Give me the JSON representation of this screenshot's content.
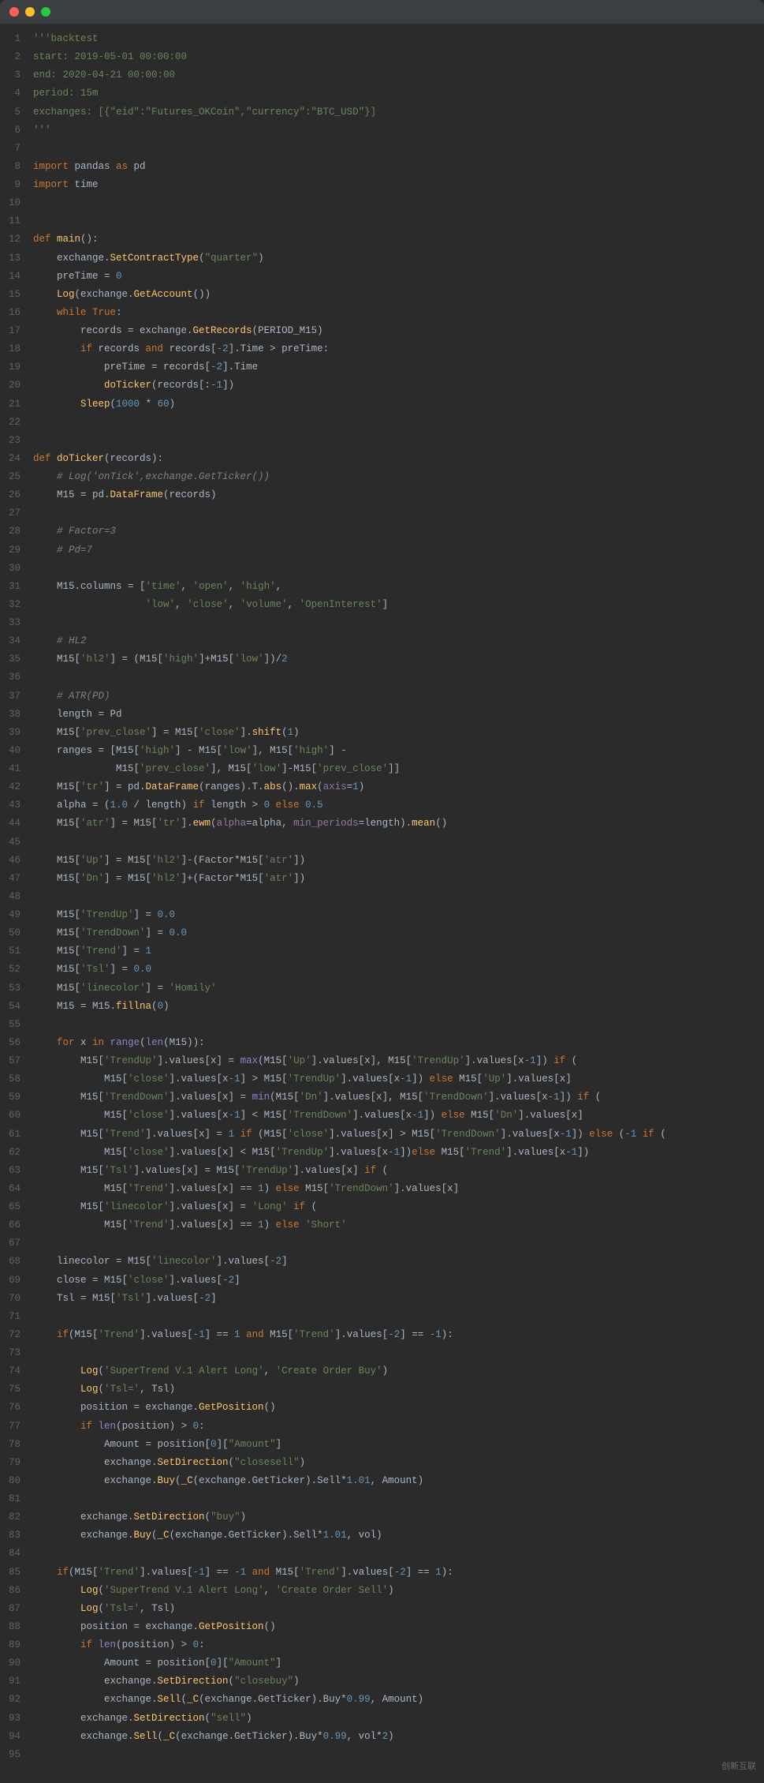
{
  "lines": [
    {
      "n": 1,
      "html": "<span class='str'>'''backtest</span>"
    },
    {
      "n": 2,
      "html": "<span class='str'>start: 2019-05-01 00:00:00</span>"
    },
    {
      "n": 3,
      "html": "<span class='str'>end: 2020-04-21 00:00:00</span>"
    },
    {
      "n": 4,
      "html": "<span class='str'>period: 15m</span>"
    },
    {
      "n": 5,
      "html": "<span class='str'>exchanges: [{\"eid\":\"Futures_OKCoin\",\"currency\":\"BTC_USD\"}]</span>"
    },
    {
      "n": 6,
      "html": "<span class='str'>'''</span>"
    },
    {
      "n": 7,
      "html": ""
    },
    {
      "n": 8,
      "html": "<span class='kw'>import</span> pandas <span class='kw'>as</span> pd"
    },
    {
      "n": 9,
      "html": "<span class='kw'>import</span> time"
    },
    {
      "n": 10,
      "html": ""
    },
    {
      "n": 11,
      "html": ""
    },
    {
      "n": 12,
      "html": "<span class='kw'>def</span> <span class='fn'>main</span>():"
    },
    {
      "n": 13,
      "html": "    exchange.<span class='fn'>SetContractType</span>(<span class='str'>\"quarter\"</span>)"
    },
    {
      "n": 14,
      "html": "    preTime = <span class='num'>0</span>"
    },
    {
      "n": 15,
      "html": "    <span class='fn'>Log</span>(exchange.<span class='fn'>GetAccount</span>())"
    },
    {
      "n": 16,
      "html": "    <span class='kw'>while</span> <span class='kw'>True</span>:"
    },
    {
      "n": 17,
      "html": "        records = exchange.<span class='fn'>GetRecords</span>(PERIOD_M15)"
    },
    {
      "n": 18,
      "html": "        <span class='kw'>if</span> records <span class='kw'>and</span> records[<span class='num'>-2</span>].Time &gt; preTime:"
    },
    {
      "n": 19,
      "html": "            preTime = records[<span class='num'>-2</span>].Time"
    },
    {
      "n": 20,
      "html": "            <span class='fn'>doTicker</span>(records[:<span class='num'>-1</span>])"
    },
    {
      "n": 21,
      "html": "        <span class='fn'>Sleep</span>(<span class='num'>1000</span> * <span class='num'>60</span>)"
    },
    {
      "n": 22,
      "html": ""
    },
    {
      "n": 23,
      "html": ""
    },
    {
      "n": 24,
      "html": "<span class='kw'>def</span> <span class='fn'>doTicker</span>(records):"
    },
    {
      "n": 25,
      "html": "    <span class='comment'># Log('onTick',exchange.GetTicker())</span>"
    },
    {
      "n": 26,
      "html": "    M15 = pd.<span class='fn'>DataFrame</span>(records)"
    },
    {
      "n": 27,
      "html": ""
    },
    {
      "n": 28,
      "html": "    <span class='comment'># Factor=3</span>"
    },
    {
      "n": 29,
      "html": "    <span class='comment'># Pd=7</span>"
    },
    {
      "n": 30,
      "html": ""
    },
    {
      "n": 31,
      "html": "    M15.columns = [<span class='str'>'time'</span>, <span class='str'>'open'</span>, <span class='str'>'high'</span>,"
    },
    {
      "n": 32,
      "html": "                   <span class='str'>'low'</span>, <span class='str'>'close'</span>, <span class='str'>'volume'</span>, <span class='str'>'OpenInterest'</span>]"
    },
    {
      "n": 33,
      "html": ""
    },
    {
      "n": 34,
      "html": "    <span class='comment'># HL2</span>"
    },
    {
      "n": 35,
      "html": "    M15[<span class='str'>'hl2'</span>] = (M15[<span class='str'>'high'</span>]+M15[<span class='str'>'low'</span>])/<span class='num'>2</span>"
    },
    {
      "n": 36,
      "html": ""
    },
    {
      "n": 37,
      "html": "    <span class='comment'># ATR(PD)</span>"
    },
    {
      "n": 38,
      "html": "    length = Pd"
    },
    {
      "n": 39,
      "html": "    M15[<span class='str'>'prev_close'</span>] = M15[<span class='str'>'close'</span>].<span class='fn'>shift</span>(<span class='num'>1</span>)"
    },
    {
      "n": 40,
      "html": "    ranges = [M15[<span class='str'>'high'</span>] - M15[<span class='str'>'low'</span>], M15[<span class='str'>'high'</span>] -"
    },
    {
      "n": 41,
      "html": "              M15[<span class='str'>'prev_close'</span>], M15[<span class='str'>'low'</span>]-M15[<span class='str'>'prev_close'</span>]]"
    },
    {
      "n": 42,
      "html": "    M15[<span class='str'>'tr'</span>] = pd.<span class='fn'>DataFrame</span>(ranges).T.<span class='fn'>abs</span>().<span class='fn'>max</span>(<span class='prop'>axis</span>=<span class='num'>1</span>)"
    },
    {
      "n": 43,
      "html": "    alpha = (<span class='num'>1.0</span> / length) <span class='kw'>if</span> length &gt; <span class='num'>0</span> <span class='kw'>else</span> <span class='num'>0.5</span>"
    },
    {
      "n": 44,
      "html": "    M15[<span class='str'>'atr'</span>] = M15[<span class='str'>'tr'</span>].<span class='fn'>ewm</span>(<span class='prop'>alpha</span>=alpha, <span class='prop'>min_periods</span>=length).<span class='fn'>mean</span>()"
    },
    {
      "n": 45,
      "html": ""
    },
    {
      "n": 46,
      "html": "    M15[<span class='str'>'Up'</span>] = M15[<span class='str'>'hl2'</span>]-(Factor*M15[<span class='str'>'atr'</span>])"
    },
    {
      "n": 47,
      "html": "    M15[<span class='str'>'Dn'</span>] = M15[<span class='str'>'hl2'</span>]+(Factor*M15[<span class='str'>'atr'</span>])"
    },
    {
      "n": 48,
      "html": ""
    },
    {
      "n": 49,
      "html": "    M15[<span class='str'>'TrendUp'</span>] = <span class='num'>0.0</span>"
    },
    {
      "n": 50,
      "html": "    M15[<span class='str'>'TrendDown'</span>] = <span class='num'>0.0</span>"
    },
    {
      "n": 51,
      "html": "    M15[<span class='str'>'Trend'</span>] = <span class='num'>1</span>"
    },
    {
      "n": 52,
      "html": "    M15[<span class='str'>'Tsl'</span>] = <span class='num'>0.0</span>"
    },
    {
      "n": 53,
      "html": "    M15[<span class='str'>'linecolor'</span>] = <span class='str'>'Homily'</span>"
    },
    {
      "n": 54,
      "html": "    M15 = M15.<span class='fn'>fillna</span>(<span class='num'>0</span>)"
    },
    {
      "n": 55,
      "html": ""
    },
    {
      "n": 56,
      "html": "    <span class='kw'>for</span> x <span class='kw'>in</span> <span class='builtin'>range</span>(<span class='builtin'>len</span>(M15)):"
    },
    {
      "n": 57,
      "html": "        M15[<span class='str'>'TrendUp'</span>].values[x] = <span class='builtin'>max</span>(M15[<span class='str'>'Up'</span>].values[x], M15[<span class='str'>'TrendUp'</span>].values[x<span class='num'>-1</span>]) <span class='kw'>if</span> ("
    },
    {
      "n": 58,
      "html": "            M15[<span class='str'>'close'</span>].values[x<span class='num'>-1</span>] &gt; M15[<span class='str'>'TrendUp'</span>].values[x<span class='num'>-1</span>]) <span class='kw'>else</span> M15[<span class='str'>'Up'</span>].values[x]"
    },
    {
      "n": 59,
      "html": "        M15[<span class='str'>'TrendDown'</span>].values[x] = <span class='builtin'>min</span>(M15[<span class='str'>'Dn'</span>].values[x], M15[<span class='str'>'TrendDown'</span>].values[x<span class='num'>-1</span>]) <span class='kw'>if</span> ("
    },
    {
      "n": 60,
      "html": "            M15[<span class='str'>'close'</span>].values[x<span class='num'>-1</span>] &lt; M15[<span class='str'>'TrendDown'</span>].values[x<span class='num'>-1</span>]) <span class='kw'>else</span> M15[<span class='str'>'Dn'</span>].values[x]"
    },
    {
      "n": 61,
      "html": "        M15[<span class='str'>'Trend'</span>].values[x] = <span class='num'>1</span> <span class='kw'>if</span> (M15[<span class='str'>'close'</span>].values[x] &gt; M15[<span class='str'>'TrendDown'</span>].values[x<span class='num'>-1</span>]) <span class='kw'>else</span> (<span class='num'>-1</span> <span class='kw'>if</span> ("
    },
    {
      "n": 62,
      "html": "            M15[<span class='str'>'close'</span>].values[x] &lt; M15[<span class='str'>'TrendUp'</span>].values[x<span class='num'>-1</span>])<span class='kw'>else</span> M15[<span class='str'>'Trend'</span>].values[x<span class='num'>-1</span>])"
    },
    {
      "n": 63,
      "html": "        M15[<span class='str'>'Tsl'</span>].values[x] = M15[<span class='str'>'TrendUp'</span>].values[x] <span class='kw'>if</span> ("
    },
    {
      "n": 64,
      "html": "            M15[<span class='str'>'Trend'</span>].values[x] == <span class='num'>1</span>) <span class='kw'>else</span> M15[<span class='str'>'TrendDown'</span>].values[x]"
    },
    {
      "n": 65,
      "html": "        M15[<span class='str'>'linecolor'</span>].values[x] = <span class='str'>'Long'</span> <span class='kw'>if</span> ("
    },
    {
      "n": 66,
      "html": "            M15[<span class='str'>'Trend'</span>].values[x] == <span class='num'>1</span>) <span class='kw'>else</span> <span class='str'>'Short'</span>"
    },
    {
      "n": 67,
      "html": ""
    },
    {
      "n": 68,
      "html": "    linecolor = M15[<span class='str'>'linecolor'</span>].values[<span class='num'>-2</span>]"
    },
    {
      "n": 69,
      "html": "    close = M15[<span class='str'>'close'</span>].values[<span class='num'>-2</span>]"
    },
    {
      "n": 70,
      "html": "    Tsl = M15[<span class='str'>'Tsl'</span>].values[<span class='num'>-2</span>]"
    },
    {
      "n": 71,
      "html": ""
    },
    {
      "n": 72,
      "html": "    <span class='kw'>if</span>(M15[<span class='str'>'Trend'</span>].values[<span class='num'>-1</span>] == <span class='num'>1</span> <span class='kw'>and</span> M15[<span class='str'>'Trend'</span>].values[<span class='num'>-2</span>] == <span class='num'>-1</span>):"
    },
    {
      "n": 73,
      "html": ""
    },
    {
      "n": 74,
      "html": "        <span class='fn'>Log</span>(<span class='str'>'SuperTrend V.1 Alert Long'</span>, <span class='str'>'Create Order Buy'</span>)"
    },
    {
      "n": 75,
      "html": "        <span class='fn'>Log</span>(<span class='str'>'Tsl='</span>, Tsl)"
    },
    {
      "n": 76,
      "html": "        position = exchange.<span class='fn'>GetPosition</span>()"
    },
    {
      "n": 77,
      "html": "        <span class='kw'>if</span> <span class='builtin'>len</span>(position) &gt; <span class='num'>0</span>:"
    },
    {
      "n": 78,
      "html": "            Amount = position[<span class='num'>0</span>][<span class='str'>\"Amount\"</span>]"
    },
    {
      "n": 79,
      "html": "            exchange.<span class='fn'>SetDirection</span>(<span class='str'>\"closesell\"</span>)"
    },
    {
      "n": 80,
      "html": "            exchange.<span class='fn'>Buy</span>(<span class='fn'>_C</span>(exchange.GetTicker).Sell*<span class='num'>1.01</span>, Amount)"
    },
    {
      "n": 81,
      "html": ""
    },
    {
      "n": 82,
      "html": "        exchange.<span class='fn'>SetDirection</span>(<span class='str'>\"buy\"</span>)"
    },
    {
      "n": 83,
      "html": "        exchange.<span class='fn'>Buy</span>(<span class='fn'>_C</span>(exchange.GetTicker).Sell*<span class='num'>1.01</span>, vol)"
    },
    {
      "n": 84,
      "html": ""
    },
    {
      "n": 85,
      "html": "    <span class='kw'>if</span>(M15[<span class='str'>'Trend'</span>].values[<span class='num'>-1</span>] == <span class='num'>-1</span> <span class='kw'>and</span> M15[<span class='str'>'Trend'</span>].values[<span class='num'>-2</span>] == <span class='num'>1</span>):"
    },
    {
      "n": 86,
      "html": "        <span class='fn'>Log</span>(<span class='str'>'SuperTrend V.1 Alert Long'</span>, <span class='str'>'Create Order Sell'</span>)"
    },
    {
      "n": 87,
      "html": "        <span class='fn'>Log</span>(<span class='str'>'Tsl='</span>, Tsl)"
    },
    {
      "n": 88,
      "html": "        position = exchange.<span class='fn'>GetPosition</span>()"
    },
    {
      "n": 89,
      "html": "        <span class='kw'>if</span> <span class='builtin'>len</span>(position) &gt; <span class='num'>0</span>:"
    },
    {
      "n": 90,
      "html": "            Amount = position[<span class='num'>0</span>][<span class='str'>\"Amount\"</span>]"
    },
    {
      "n": 91,
      "html": "            exchange.<span class='fn'>SetDirection</span>(<span class='str'>\"closebuy\"</span>)"
    },
    {
      "n": 92,
      "html": "            exchange.<span class='fn'>Sell</span>(<span class='fn'>_C</span>(exchange.GetTicker).Buy*<span class='num'>0.99</span>, Amount)"
    },
    {
      "n": 93,
      "html": "        exchange.<span class='fn'>SetDirection</span>(<span class='str'>\"sell\"</span>)"
    },
    {
      "n": 94,
      "html": "        exchange.<span class='fn'>Sell</span>(<span class='fn'>_C</span>(exchange.GetTicker).Buy*<span class='num'>0.99</span>, vol*<span class='num'>2</span>)"
    },
    {
      "n": 95,
      "html": ""
    }
  ],
  "watermark": "创新互联"
}
